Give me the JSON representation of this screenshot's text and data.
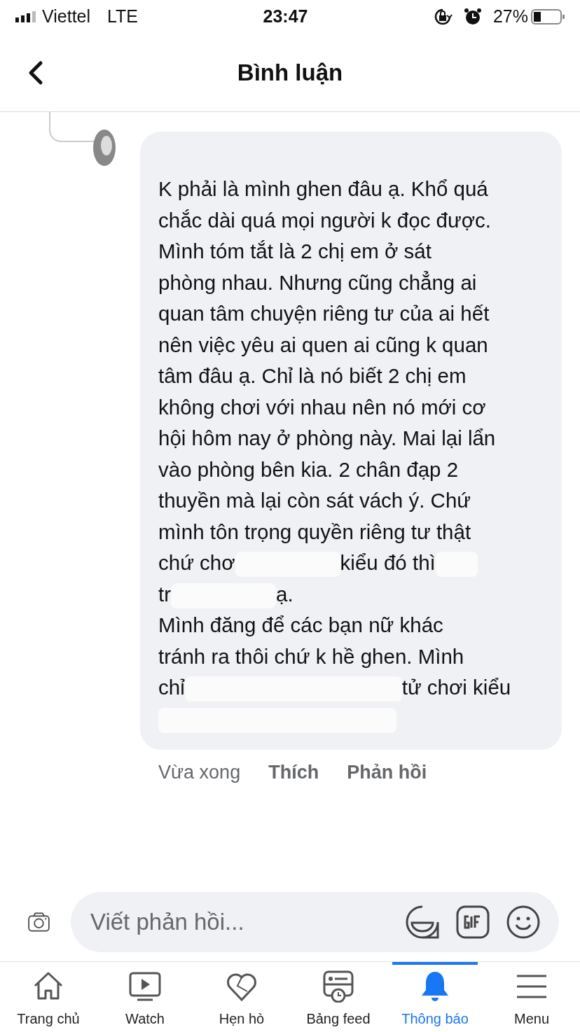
{
  "status_bar": {
    "carrier": "Viettel",
    "network": "LTE",
    "time": "23:47",
    "battery": "27%"
  },
  "header": {
    "title": "Bình luận"
  },
  "comment": {
    "lines": [
      [
        "K phải là mình ghen đâu ạ. Khổ quá"
      ],
      [
        "chắc dài quá mọi người k đọc được."
      ],
      [
        "Mình tóm tắt là 2 chị em ở sát"
      ],
      [
        "phòng nhau. Nhưng cũng chẳng ai"
      ],
      [
        "quan tâm chuyện riêng tư của ai hết"
      ],
      [
        "nên việc yêu ai quen ai cũng k quan"
      ],
      [
        "tâm đâu ạ. Chỉ là nó biết 2 chị em"
      ],
      [
        "không chơi với nhau nên nó mới cơ"
      ],
      [
        "hội hôm nay ở phòng này. Mai lại lẩn"
      ],
      [
        "vào phòng bên kia. 2 chân đạp 2"
      ],
      [
        "thuyền mà lại còn sát vách ý. Chứ"
      ],
      [
        "mình tôn trọng quyền riêng tư thật"
      ],
      [
        "chứ chơ",
        "kiểu đó thì"
      ],
      [
        "tr",
        "ạ."
      ],
      [
        "Mình đăng để các bạn nữ khác"
      ],
      [
        "tránh ra thôi chứ k hề ghen. Mình"
      ],
      [
        "chỉ",
        "tử chơi kiểu"
      ]
    ],
    "actions": [
      {
        "label": "Vừa xong",
        "kind": "time"
      },
      {
        "label": "Thích",
        "kind": "button"
      },
      {
        "label": "Phản hồi",
        "kind": "button"
      }
    ]
  },
  "reply_bar": {
    "placeholder": "Viết phản hồi..."
  },
  "tabs": [
    {
      "label": "Trang chủ",
      "selected": false
    },
    {
      "label": "Watch",
      "selected": false
    },
    {
      "label": "Hẹn hò",
      "selected": false
    },
    {
      "label": "Bảng feed",
      "selected": false
    },
    {
      "label": "Thông báo",
      "selected": true
    },
    {
      "label": "Menu",
      "selected": false
    }
  ]
}
